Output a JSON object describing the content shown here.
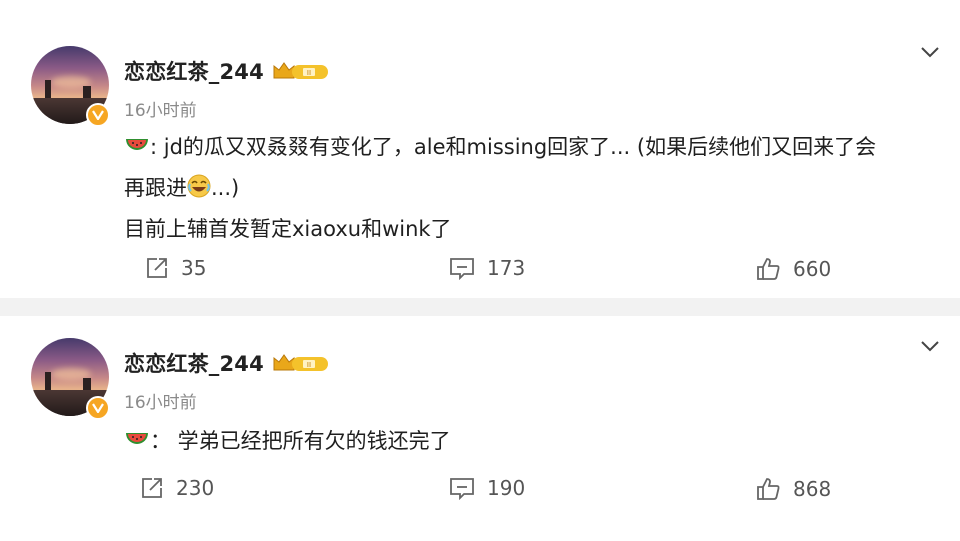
{
  "posts": [
    {
      "username": "恋恋红茶_244",
      "time": "16小时前",
      "lines": [
        ": jd的瓜又双叒叕有变化了，ale和missing回家了... (如果后续他们又回来了会",
        "再跟进",
        "...)",
        "目前上辅首发暂定xiaoxu和wink了"
      ],
      "repost_count": "35",
      "comment_count": "173",
      "like_count": "660"
    },
    {
      "username": "恋恋红茶_244",
      "time": "16小时前",
      "lines": [
        "：  学弟已经把所有欠的钱还完了"
      ],
      "repost_count": "230",
      "comment_count": "190",
      "like_count": "868"
    }
  ],
  "colors": {
    "verified_badge": "#f6a623",
    "member_badge": "#f4c22b",
    "page_background": "#f2f2f2"
  }
}
